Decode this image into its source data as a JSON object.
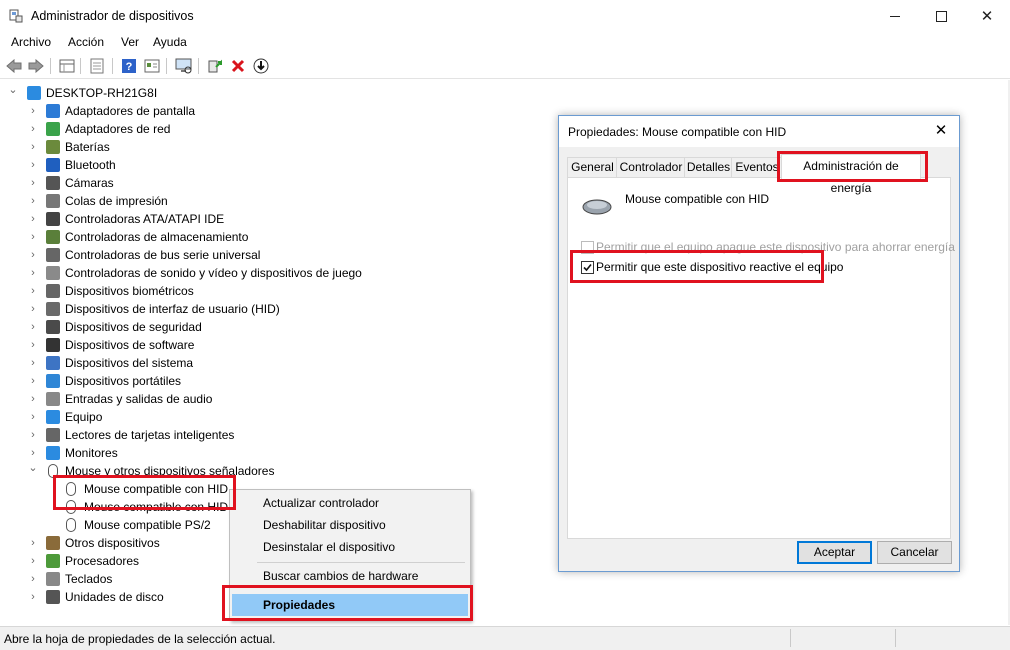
{
  "window": {
    "title": "Administrador de dispositivos",
    "controls": [
      "minimize-icon",
      "maximize-icon",
      "close-icon"
    ]
  },
  "menu": [
    "Archivo",
    "Acción",
    "Ver",
    "Ayuda"
  ],
  "toolbar": [
    "back-icon",
    "forward-icon",
    "properties-grid-icon",
    "list-view-icon",
    "help-icon",
    "resources-icon",
    "monitor-scan-icon",
    "update-driver-icon",
    "uninstall-icon",
    "download-icon"
  ],
  "tree": {
    "root": "DESKTOP-RH21G8I",
    "categories": [
      {
        "label": "Adaptadores de pantalla",
        "icon": "display-adapter-icon"
      },
      {
        "label": "Adaptadores de red",
        "icon": "network-adapter-icon"
      },
      {
        "label": "Baterías",
        "icon": "battery-icon"
      },
      {
        "label": "Bluetooth",
        "icon": "bluetooth-icon"
      },
      {
        "label": "Cámaras",
        "icon": "camera-icon"
      },
      {
        "label": "Colas de impresión",
        "icon": "printer-icon"
      },
      {
        "label": "Controladoras ATA/ATAPI IDE",
        "icon": "ide-controller-icon"
      },
      {
        "label": "Controladoras de almacenamiento",
        "icon": "storage-controller-icon"
      },
      {
        "label": "Controladoras de bus serie universal",
        "icon": "usb-icon"
      },
      {
        "label": "Controladoras de sonido y vídeo y dispositivos de juego",
        "icon": "sound-icon"
      },
      {
        "label": "Dispositivos biométricos",
        "icon": "fingerprint-icon"
      },
      {
        "label": "Dispositivos de interfaz de usuario (HID)",
        "icon": "hid-icon"
      },
      {
        "label": "Dispositivos de seguridad",
        "icon": "security-device-icon"
      },
      {
        "label": "Dispositivos de software",
        "icon": "software-device-icon"
      },
      {
        "label": "Dispositivos del sistema",
        "icon": "system-device-icon"
      },
      {
        "label": "Dispositivos portátiles",
        "icon": "portable-device-icon"
      },
      {
        "label": "Entradas y salidas de audio",
        "icon": "audio-io-icon"
      },
      {
        "label": "Equipo",
        "icon": "computer-icon"
      },
      {
        "label": "Lectores de tarjetas inteligentes",
        "icon": "smartcard-reader-icon"
      },
      {
        "label": "Monitores",
        "icon": "monitor-icon"
      },
      {
        "label": "Mouse y otros dispositivos señaladores",
        "icon": "mouse-icon",
        "expanded": true,
        "children": [
          "Mouse compatible con HID",
          "Mouse compatible con HID",
          "Mouse compatible PS/2"
        ]
      },
      {
        "label": "Otros dispositivos",
        "icon": "other-device-icon"
      },
      {
        "label": "Procesadores",
        "icon": "processor-icon"
      },
      {
        "label": "Teclados",
        "icon": "keyboard-icon"
      },
      {
        "label": "Unidades de disco",
        "icon": "disk-drive-icon"
      }
    ]
  },
  "context_menu": {
    "items": [
      "Actualizar controlador",
      "Deshabilitar dispositivo",
      "Desinstalar el dispositivo",
      "Buscar cambios de hardware",
      "Propiedades"
    ],
    "selected": "Propiedades"
  },
  "dialog": {
    "title": "Propiedades: Mouse compatible con HID",
    "tabs": [
      "General",
      "Controlador",
      "Detalles",
      "Eventos",
      "Administración de energía"
    ],
    "active_tab": "Administración de energía",
    "device_name": "Mouse compatible con HID",
    "option_power_off": {
      "label": "Permitir que el equipo apague este dispositivo para ahorrar energía",
      "checked": false,
      "enabled": false
    },
    "option_wake": {
      "label": "Permitir que este dispositivo reactive el equipo",
      "checked": true,
      "enabled": true
    },
    "buttons": {
      "accept": "Aceptar",
      "cancel": "Cancelar"
    }
  },
  "status": {
    "text": "Abre la hoja de propiedades de la selección actual."
  },
  "colors": {
    "highlight": "#e0121f",
    "selection": "#91c9f7",
    "accent": "#0078d7"
  }
}
